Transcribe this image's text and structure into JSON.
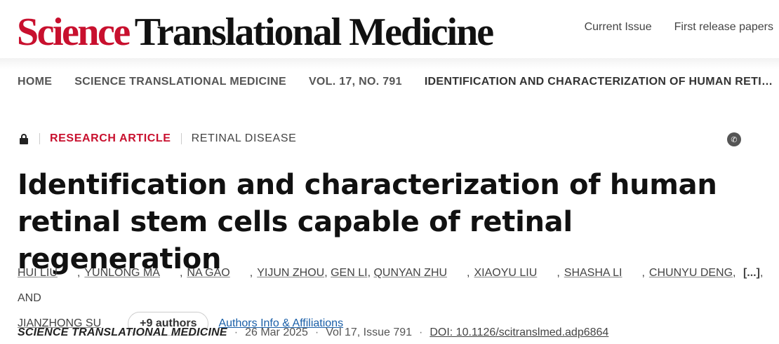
{
  "header": {
    "logo_science": "Science",
    "logo_rest": "Translational Medicine",
    "nav": [
      "Current Issue",
      "First release papers"
    ]
  },
  "breadcrumb": [
    "HOME",
    "SCIENCE TRANSLATIONAL MEDICINE",
    "VOL. 17, NO. 791",
    "IDENTIFICATION AND CHARACTERIZATION OF HUMAN RETINAL STEM CELLS CAPABLE OF RETINAL REGENERATION"
  ],
  "meta": {
    "article_type": "RESEARCH ARTICLE",
    "subject": "RETINAL DISEASE"
  },
  "article": {
    "title": "Identification and characterization of human retinal stem cells capable of retinal regeneration"
  },
  "authors": {
    "list": [
      "HUI LIU",
      "YUNLONG MA",
      "NA GAO",
      "YIJUN ZHOU",
      "GEN LI",
      "QUNYAN ZHU",
      "XIAOYU LIU",
      "SHASHA LI",
      "CHUNYU DENG"
    ],
    "more_marker": "[...]",
    "and": "AND",
    "last": "JIANZHONG SU",
    "more_button": "+9 authors",
    "affiliations_link": "Authors Info & Affiliations"
  },
  "citation": {
    "journal": "SCIENCE TRANSLATIONAL MEDICINE",
    "date": "26 Mar 2025",
    "volume": "Vol 17, Issue 791",
    "doi": "DOI: 10.1126/scitranslmed.adp6864"
  },
  "colors": {
    "brand": "#c8102e",
    "link": "#1a5fa8"
  }
}
